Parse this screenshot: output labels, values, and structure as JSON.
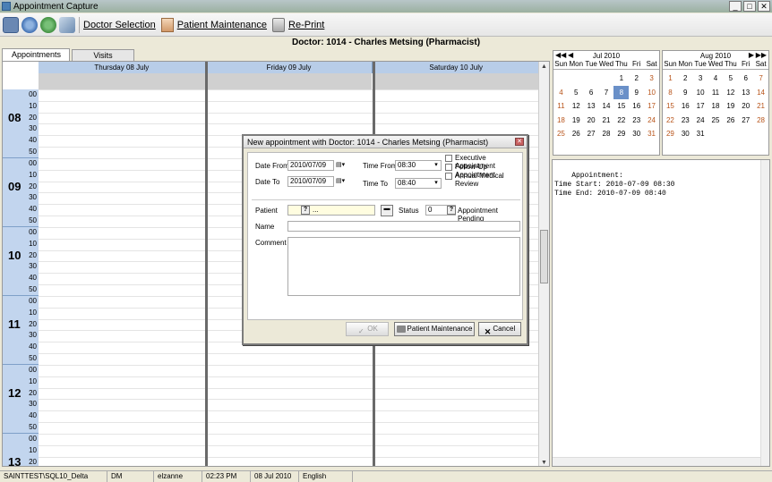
{
  "window": {
    "title": "Appointment Capture"
  },
  "toolbar": {
    "doctor_selection": "Doctor Selection",
    "patient_maintenance": "Patient Maintenance",
    "reprint": "Re-Print"
  },
  "header": {
    "doctor": "Doctor: 1014 - Charles Metsing (Pharmacist)"
  },
  "tabs": [
    {
      "label": "Appointments",
      "active": true
    },
    {
      "label": "Visits",
      "active": false
    }
  ],
  "scheduler": {
    "days": [
      "Thursday 08 July",
      "Friday 09 July",
      "Saturday 10 July"
    ],
    "hours": [
      "08",
      "09",
      "10",
      "11",
      "12",
      "13"
    ],
    "minutes": [
      "00",
      "10",
      "20",
      "30",
      "40",
      "50"
    ]
  },
  "calendar_jul": {
    "month": "Jul 2010",
    "dow": [
      "Sun",
      "Mon",
      "Tue",
      "Wed",
      "Thu",
      "Fri",
      "Sat"
    ],
    "weeks": [
      [
        "",
        "",
        "",
        "",
        "1",
        "2",
        "3"
      ],
      [
        "4",
        "5",
        "6",
        "7",
        "8",
        "9",
        "10"
      ],
      [
        "11",
        "12",
        "13",
        "14",
        "15",
        "16",
        "17"
      ],
      [
        "18",
        "19",
        "20",
        "21",
        "22",
        "23",
        "24"
      ],
      [
        "25",
        "26",
        "27",
        "28",
        "29",
        "30",
        "31"
      ]
    ],
    "selected": "8"
  },
  "calendar_aug": {
    "month": "Aug 2010",
    "dow": [
      "Sun",
      "Mon",
      "Tue",
      "Wed",
      "Thu",
      "Fri",
      "Sat"
    ],
    "weeks": [
      [
        "1",
        "2",
        "3",
        "4",
        "5",
        "6",
        "7"
      ],
      [
        "8",
        "9",
        "10",
        "11",
        "12",
        "13",
        "14"
      ],
      [
        "15",
        "16",
        "17",
        "18",
        "19",
        "20",
        "21"
      ],
      [
        "22",
        "23",
        "24",
        "25",
        "26",
        "27",
        "28"
      ],
      [
        "29",
        "30",
        "31",
        "",
        "",
        "",
        ""
      ]
    ]
  },
  "notes": {
    "text": "Appointment:\nTime Start: 2010-07-09 08:30\nTime End: 2010-07-09 08:40"
  },
  "dialog": {
    "title": "New appointment with Doctor: 1014 - Charles Metsing (Pharmacist)",
    "date_from_label": "Date From",
    "date_from": "2010/07/09",
    "date_to_label": "Date To",
    "date_to": "2010/07/09",
    "time_from_label": "Time From",
    "time_from": "08:30",
    "time_to_label": "Time To",
    "time_to": "08:40",
    "checks": [
      "Executive Appointment",
      "Follow-Up Appointment",
      "Annual Medical Review"
    ],
    "patient_label": "Patient",
    "patient_value": "",
    "patient_ellipsis": "...",
    "status_label": "Status",
    "status_value": "0",
    "status_text": "Appointment Pending",
    "name_label": "Name",
    "comment_label": "Comment",
    "ok_label": "OK",
    "patient_maintenance_label": "Patient Maintenance",
    "cancel_label": "Cancel"
  },
  "status_bar": {
    "server": "SAINTTEST\\SQL10_Delta",
    "code": "DM",
    "user": "elzanne",
    "time": "02:23 PM",
    "date": "08 Jul 2010",
    "language": "English"
  }
}
